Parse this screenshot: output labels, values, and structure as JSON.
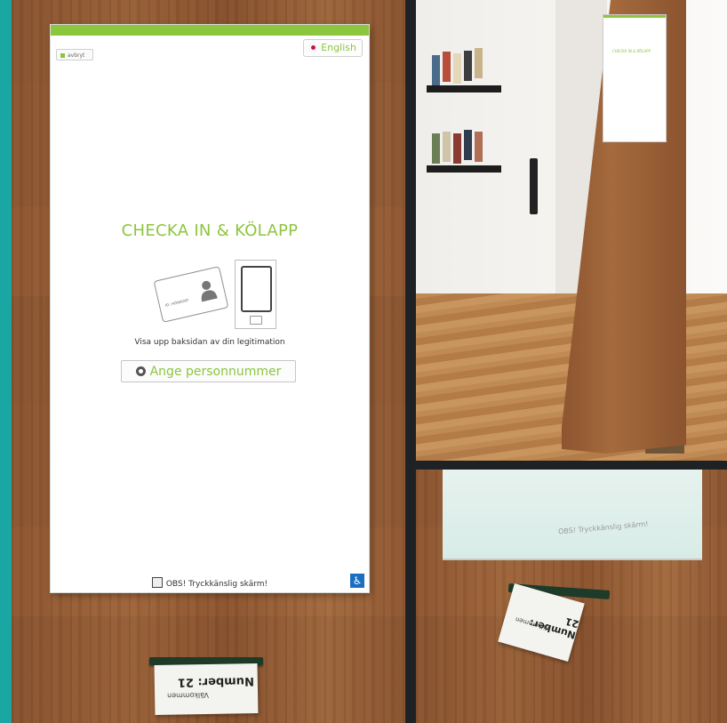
{
  "kiosk_screen": {
    "back_button_label": "avbryt",
    "language_button_label": "English",
    "title": "CHECKA IN & KÖLAPP",
    "card_text": "ID / KÖRKORT",
    "instruction": "Visa upp baksidan av din legitimation",
    "personnummer_button_label": "Ange personnummer",
    "notice": "OBS! Tryckkänslig skärm!",
    "accent_color": "#8cc63e",
    "accessibility_icon": "wheelchair-icon"
  },
  "ticket": {
    "number_text": "Number: 21",
    "signature": "Välkommen"
  },
  "small_kiosk_screen": {
    "title": "CHECKA IN & KÖLAPP"
  },
  "closeup": {
    "notice": "OBS! Tryckkänslig skärm!",
    "ticket_number_text": "Number: 21"
  }
}
